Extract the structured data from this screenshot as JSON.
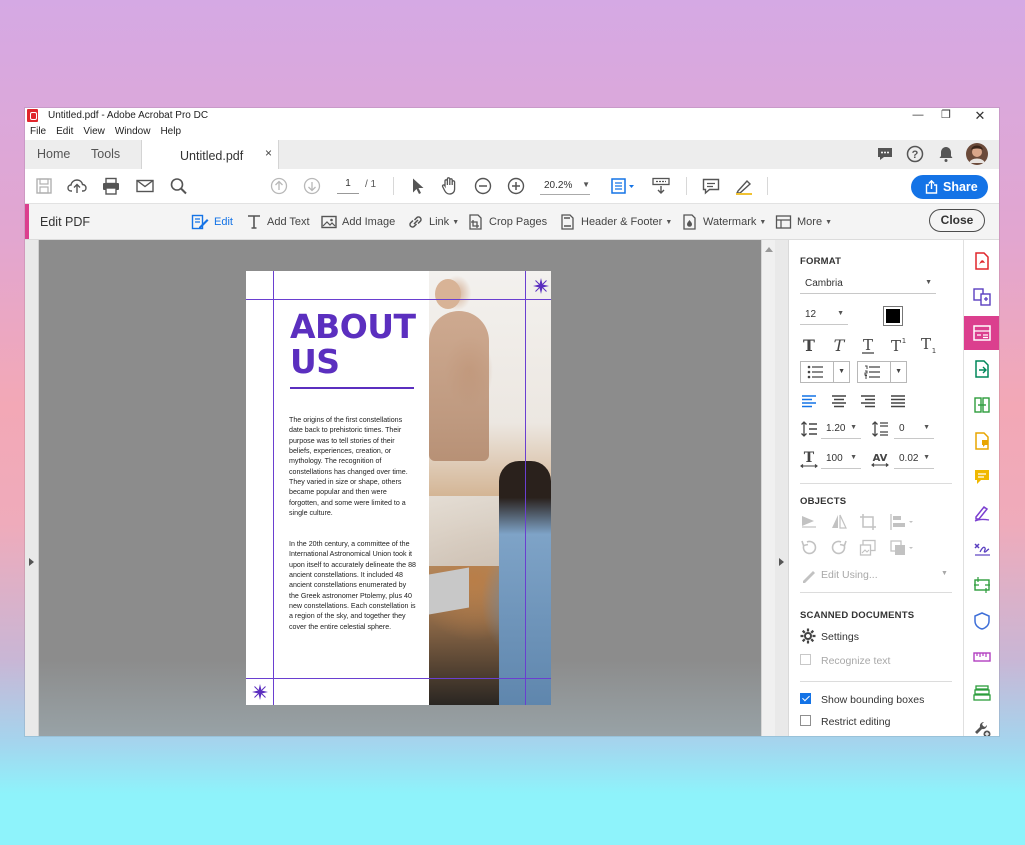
{
  "window": {
    "title": "Untitled.pdf - Adobe Acrobat Pro DC",
    "minimize_glyph": "—",
    "restore_glyph": "❐",
    "close_glyph": "✕"
  },
  "menu": [
    "File",
    "Edit",
    "View",
    "Window",
    "Help"
  ],
  "tabs": {
    "home": "Home",
    "tools": "Tools",
    "document": "Untitled.pdf",
    "close_glyph": "×"
  },
  "toolbar": {
    "page_current": "1",
    "page_total": "/ 1",
    "zoom": "20.2%",
    "share_label": "Share"
  },
  "editbar": {
    "title": "Edit PDF",
    "tools": [
      {
        "label": "Edit",
        "active": true,
        "dropdown": false
      },
      {
        "label": "Add Text",
        "dropdown": false
      },
      {
        "label": "Add Image",
        "dropdown": false
      },
      {
        "label": "Link",
        "dropdown": true
      },
      {
        "label": "Crop Pages",
        "dropdown": false
      },
      {
        "label": "Header & Footer",
        "dropdown": true
      },
      {
        "label": "Watermark",
        "dropdown": true
      },
      {
        "label": "More",
        "dropdown": true
      }
    ],
    "close_label": "Close"
  },
  "document": {
    "heading_line1": "ABOUT",
    "heading_line2": "US",
    "paragraph1": "The origins of the first constellations date back to prehistoric times. Their purpose was to tell stories of their beliefs, experiences, creation, or mythology. The recognition of constellations has changed over time. They varied in size or shape, others became popular and then were forgotten, and some were limited to a single culture.",
    "paragraph2": "In the 20th century, a committee of the International Astronomical Union took it upon itself to accurately delineate the 88 ancient constellations. It included 48 ancient constellations enumerated by the Greek astronomer Ptolemy, plus 40 new constellations. Each constellation is a region of the sky, and together they cover the entire celestial sphere.",
    "accent_color": "#5b2fbf"
  },
  "format_panel": {
    "section_format": "FORMAT",
    "font_family": "Cambria",
    "font_size": "12",
    "text_color": "#000000",
    "line_spacing": "1.20",
    "paragraph_spacing": "0",
    "horizontal_scaling": "100",
    "character_spacing": "0.02",
    "section_objects": "OBJECTS",
    "edit_using": "Edit Using...",
    "section_scanned": "SCANNED DOCUMENTS",
    "settings": "Settings",
    "recognize_text": "Recognize text",
    "show_bounding_boxes": "Show bounding boxes",
    "show_bounding_boxes_checked": true,
    "restrict_editing": "Restrict editing",
    "restrict_editing_checked": false
  },
  "colors": {
    "accent_pink": "#db3f8e",
    "share_blue": "#1473e6",
    "canvas_gray": "#8c8c8c"
  }
}
